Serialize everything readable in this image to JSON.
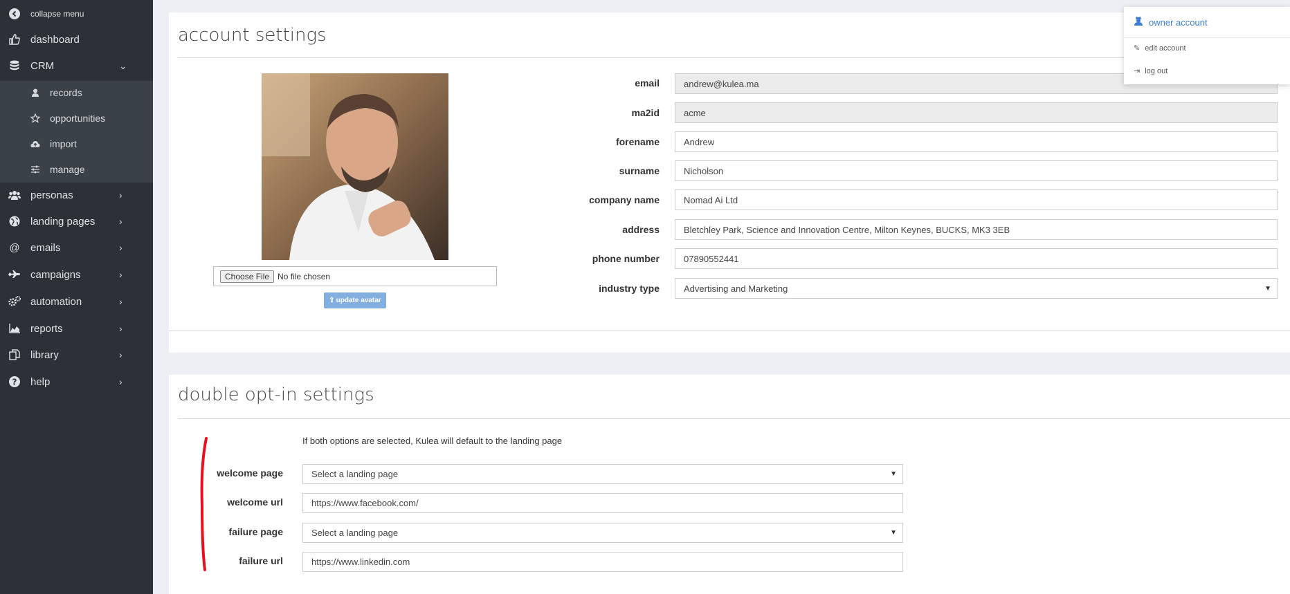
{
  "sidebar": {
    "collapse_label": "collapse menu",
    "items": [
      {
        "label": "dashboard",
        "icon": "thumbs-up-icon"
      },
      {
        "label": "CRM",
        "icon": "database-icon"
      },
      {
        "label": "personas",
        "icon": "users-icon"
      },
      {
        "label": "landing pages",
        "icon": "globe-icon"
      },
      {
        "label": "emails",
        "icon": "at-icon"
      },
      {
        "label": "campaigns",
        "icon": "plane-icon"
      },
      {
        "label": "automation",
        "icon": "gears-icon"
      },
      {
        "label": "reports",
        "icon": "area-chart-icon"
      },
      {
        "label": "library",
        "icon": "files-icon"
      },
      {
        "label": "help",
        "icon": "question-icon"
      }
    ],
    "crm_sub": [
      {
        "label": "records",
        "icon": "user-icon"
      },
      {
        "label": "opportunities",
        "icon": "star-icon"
      },
      {
        "label": "import",
        "icon": "cloud-upload-icon"
      },
      {
        "label": "manage",
        "icon": "sliders-icon"
      }
    ]
  },
  "account": {
    "title": "account settings",
    "file_button": "Choose File",
    "file_status": "No file chosen",
    "update_avatar": "update avatar",
    "fields": {
      "email": {
        "label": "email",
        "value": "andrew@kulea.ma"
      },
      "ma2id": {
        "label": "ma2id",
        "value": "acme"
      },
      "forename": {
        "label": "forename",
        "value": "Andrew"
      },
      "surname": {
        "label": "surname",
        "value": "Nicholson"
      },
      "company": {
        "label": "company name",
        "value": "Nomad Ai Ltd"
      },
      "address": {
        "label": "address",
        "value": "Bletchley Park, Science and Innovation Centre, Milton Keynes, BUCKS, MK3 3EB"
      },
      "phone": {
        "label": "phone number",
        "value": "07890552441"
      },
      "industry": {
        "label": "industry type",
        "value": "Advertising and Marketing"
      }
    }
  },
  "optin": {
    "title": "double opt-in settings",
    "hint": "If both options are selected, Kulea will default to the landing page",
    "welcome_page": {
      "label": "welcome page",
      "value": "Select a landing page"
    },
    "welcome_url": {
      "label": "welcome url",
      "value": "https://www.facebook.com/"
    },
    "failure_page": {
      "label": "failure page",
      "value": "Select a landing page"
    },
    "failure_url": {
      "label": "failure url",
      "value": "https://www.linkedin.com"
    }
  },
  "user_menu": {
    "owner": "owner account",
    "edit": "edit account",
    "logout": "log out"
  },
  "colors": {
    "sidebar_bg": "#2b3136",
    "submenu_bg": "#3a4147",
    "accent": "#3b7dd8",
    "button": "#82aee0",
    "annotation": "#e8101e"
  }
}
